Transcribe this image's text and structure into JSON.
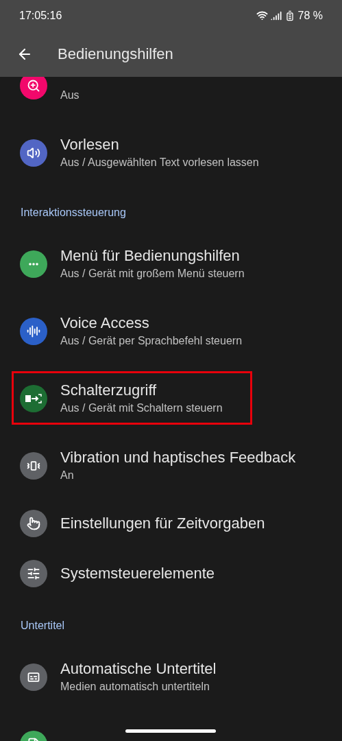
{
  "status_bar": {
    "time": "17:05:16",
    "battery": "78 %"
  },
  "app_bar": {
    "title": "Bedienungshilfen"
  },
  "list": [
    {
      "kind": "item",
      "subtitle": "Aus",
      "color": "#f2086b",
      "highlighted": false
    },
    {
      "kind": "item",
      "title": "Vorlesen",
      "subtitle": "Aus / Ausgewählten Text vorlesen lassen",
      "color": "#5266c4",
      "highlighted": false
    },
    {
      "kind": "header",
      "title": "Interaktionssteuerung"
    },
    {
      "kind": "item",
      "title": "Menü für Bedienungshilfen",
      "subtitle": "Aus / Gerät mit großem Menü steuern",
      "color": "#3ea85a",
      "highlighted": false
    },
    {
      "kind": "item",
      "title": "Voice Access",
      "subtitle": "Aus / Gerät per Sprachbefehl steuern",
      "color": "#2b60c8",
      "highlighted": false
    },
    {
      "kind": "item",
      "title": "Schalterzugriff",
      "subtitle": "Aus / Gerät mit Schaltern steuern",
      "color": "#1d6d33",
      "highlighted": true
    },
    {
      "kind": "item",
      "title": "Vibration und haptisches Feedback",
      "subtitle": "An",
      "color": "#5f6165",
      "highlighted": false
    },
    {
      "kind": "item",
      "title": "Einstellungen für Zeitvorgaben",
      "color": "#5f6165",
      "highlighted": false
    },
    {
      "kind": "item",
      "title": "Systemsteuerelemente",
      "color": "#5f6165",
      "highlighted": false
    },
    {
      "kind": "header",
      "title": "Untertitel"
    },
    {
      "kind": "item",
      "title": "Automatische Untertitel",
      "subtitle": "Medien automatisch untertiteln",
      "color": "#5f6165",
      "highlighted": false
    },
    {
      "kind": "item",
      "color": "#3ea85a",
      "highlighted": false
    }
  ]
}
